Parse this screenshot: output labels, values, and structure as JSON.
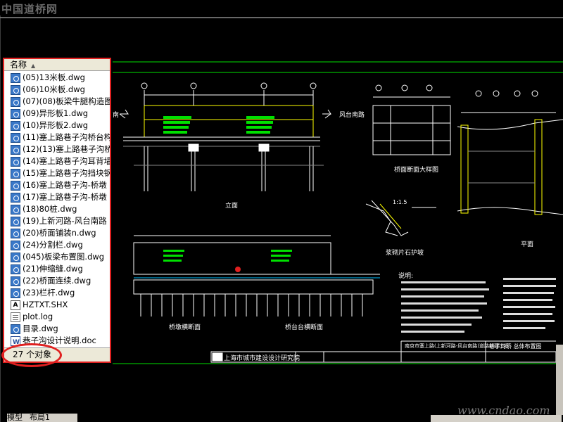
{
  "watermark_top": "中国道桥网",
  "watermark_bottom": "www.cndao.com",
  "panel": {
    "header_label": "名称",
    "items": [
      {
        "label": "(05)13米板.dwg",
        "type": "dwg"
      },
      {
        "label": "(06)10米板.dwg",
        "type": "dwg"
      },
      {
        "label": "(07)(08)板梁牛腿构造图",
        "type": "dwg"
      },
      {
        "label": "(09)异形板1.dwg",
        "type": "dwg"
      },
      {
        "label": "(10)异形板2.dwg",
        "type": "dwg"
      },
      {
        "label": "(11)塞上路巷子沟桥台构",
        "type": "dwg"
      },
      {
        "label": "(12)(13)塞上路巷子沟桥",
        "type": "dwg"
      },
      {
        "label": "(14)塞上路巷子沟耳背墙",
        "type": "dwg"
      },
      {
        "label": "(15)塞上路巷子沟挡块钢",
        "type": "dwg"
      },
      {
        "label": "(16)塞上路巷子沟-桥墩",
        "type": "dwg"
      },
      {
        "label": "(17)塞上路巷子沟-桥墩",
        "type": "dwg"
      },
      {
        "label": "(18)80桩.dwg",
        "type": "dwg"
      },
      {
        "label": "(19)上新河路-风台南路",
        "type": "dwg"
      },
      {
        "label": "(20)桥面铺装n.dwg",
        "type": "dwg"
      },
      {
        "label": "(24)分割栏.dwg",
        "type": "dwg"
      },
      {
        "label": "(045)板梁布置图.dwg",
        "type": "dwg"
      },
      {
        "label": "(21)伸缩缝.dwg",
        "type": "dwg"
      },
      {
        "label": "(22)桥面连续.dwg",
        "type": "dwg"
      },
      {
        "label": "(23)栏杆.dwg",
        "type": "dwg"
      },
      {
        "label": "HZTXT.SHX",
        "type": "shx"
      },
      {
        "label": "plot.log",
        "type": "log"
      },
      {
        "label": "目录.dwg",
        "type": "dwg"
      },
      {
        "label": "巷子沟设计说明.doc",
        "type": "doc"
      }
    ],
    "status": "27 个对象"
  },
  "cad": {
    "label_left_dir": "南",
    "label_right_dir": "风台南路",
    "label_elevation": "立面",
    "label_section_detail": "桥面断面大样图",
    "label_slope": "浆砌片石护坡",
    "label_plan": "平面",
    "label_section_pier": "桥墩横断面",
    "label_section_abutment": "桥台台横断面",
    "label_notes": "说明:",
    "slope_ratio": "1:1.5",
    "title_org": "上海市城市建设设计研究院",
    "title_project": "南京市塞上路(上新河路-风台南路)道路新建工程",
    "title_drawing": "巷子沟桥 总体布置图",
    "scale": "1:200"
  },
  "tabs": {
    "model": "模型",
    "layout": "布局1"
  },
  "colors": {
    "lines": "#ffffff",
    "cad_green": "#00e000",
    "cad_yellow": "#ffff00",
    "cad_cyan": "#00c0ff",
    "highlight": "#e02020"
  }
}
